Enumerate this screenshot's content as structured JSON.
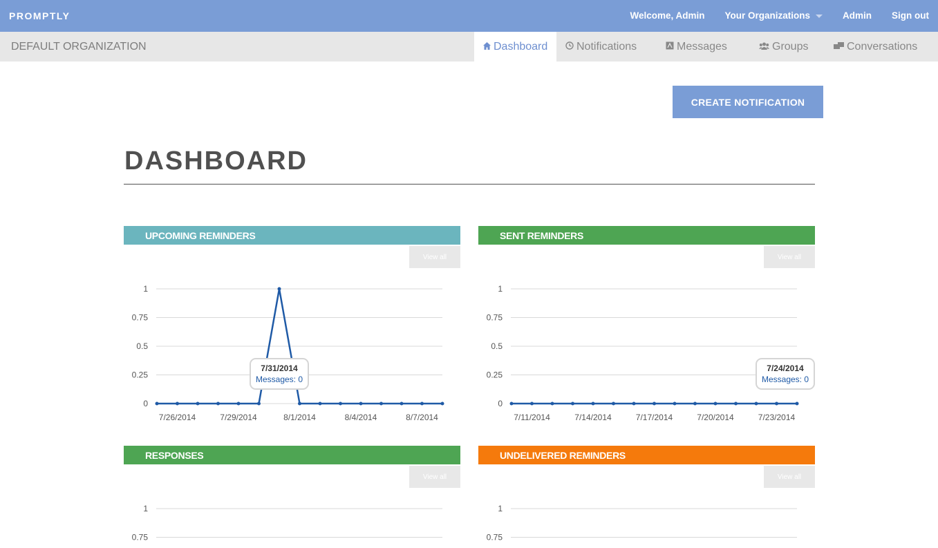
{
  "brand": "PROMPTLY",
  "topnav": {
    "welcome": "Welcome, Admin",
    "orgs": "Your Organizations",
    "admin": "Admin",
    "signout": "Sign out"
  },
  "org_name": "DEFAULT ORGANIZATION",
  "tabs": [
    {
      "label": "Dashboard",
      "icon": "home-icon",
      "active": true
    },
    {
      "label": "Notifications",
      "icon": "clock-icon",
      "active": false
    },
    {
      "label": "Messages",
      "icon": "message-icon",
      "active": false
    },
    {
      "label": "Groups",
      "icon": "groups-icon",
      "active": false
    },
    {
      "label": "Conversations",
      "icon": "conversations-icon",
      "active": false
    }
  ],
  "create_button": "CREATE NOTIFICATION",
  "page_title": "DASHBOARD",
  "colors": {
    "topbar": "#7a9dd6",
    "upcoming": "#6bb5be",
    "sent": "#4ea553",
    "responses": "#4ea553",
    "undelivered": "#f57a0c",
    "line": "#1f5aa6"
  },
  "panels": [
    {
      "title": "UPCOMING REMINDERS",
      "view_all": "View all"
    },
    {
      "title": "SENT REMINDERS",
      "view_all": "View all"
    },
    {
      "title": "RESPONSES",
      "view_all": "View all"
    },
    {
      "title": "UNDELIVERED REMINDERS",
      "view_all": "View all"
    }
  ],
  "chart_data": [
    {
      "type": "line",
      "y_ticks": [
        "1",
        "0.75",
        "0.5",
        "0.25",
        "0"
      ],
      "ylim": [
        0,
        1
      ],
      "x_tick_labels": [
        "7/26/2014",
        "7/29/2014",
        "8/1/2014",
        "8/4/2014",
        "8/7/2014"
      ],
      "x": [
        "7/25/2014",
        "7/26/2014",
        "7/27/2014",
        "7/28/2014",
        "7/29/2014",
        "7/30/2014",
        "7/31/2014",
        "8/1/2014",
        "8/2/2014",
        "8/3/2014",
        "8/4/2014",
        "8/5/2014",
        "8/6/2014",
        "8/7/2014",
        "8/8/2014"
      ],
      "values": [
        0,
        0,
        0,
        0,
        0,
        0,
        1,
        0,
        0,
        0,
        0,
        0,
        0,
        0,
        0
      ],
      "tooltip": {
        "date": "7/31/2014",
        "label": "Messages: 0"
      }
    },
    {
      "type": "line",
      "y_ticks": [
        "1",
        "0.75",
        "0.5",
        "0.25",
        "0"
      ],
      "ylim": [
        0,
        1
      ],
      "x_tick_labels": [
        "7/11/2014",
        "7/14/2014",
        "7/17/2014",
        "7/20/2014",
        "7/23/2014"
      ],
      "x": [
        "7/10/2014",
        "7/11/2014",
        "7/12/2014",
        "7/13/2014",
        "7/14/2014",
        "7/15/2014",
        "7/16/2014",
        "7/17/2014",
        "7/18/2014",
        "7/19/2014",
        "7/20/2014",
        "7/21/2014",
        "7/22/2014",
        "7/23/2014",
        "7/24/2014"
      ],
      "values": [
        0,
        0,
        0,
        0,
        0,
        0,
        0,
        0,
        0,
        0,
        0,
        0,
        0,
        0,
        0
      ],
      "tooltip": {
        "date": "7/24/2014",
        "label": "Messages: 0"
      }
    },
    {
      "type": "line",
      "y_ticks": [
        "1",
        "0.75"
      ],
      "ylim": [
        0,
        1
      ]
    },
    {
      "type": "line",
      "y_ticks": [
        "1",
        "0.75"
      ],
      "ylim": [
        0,
        1
      ]
    }
  ]
}
